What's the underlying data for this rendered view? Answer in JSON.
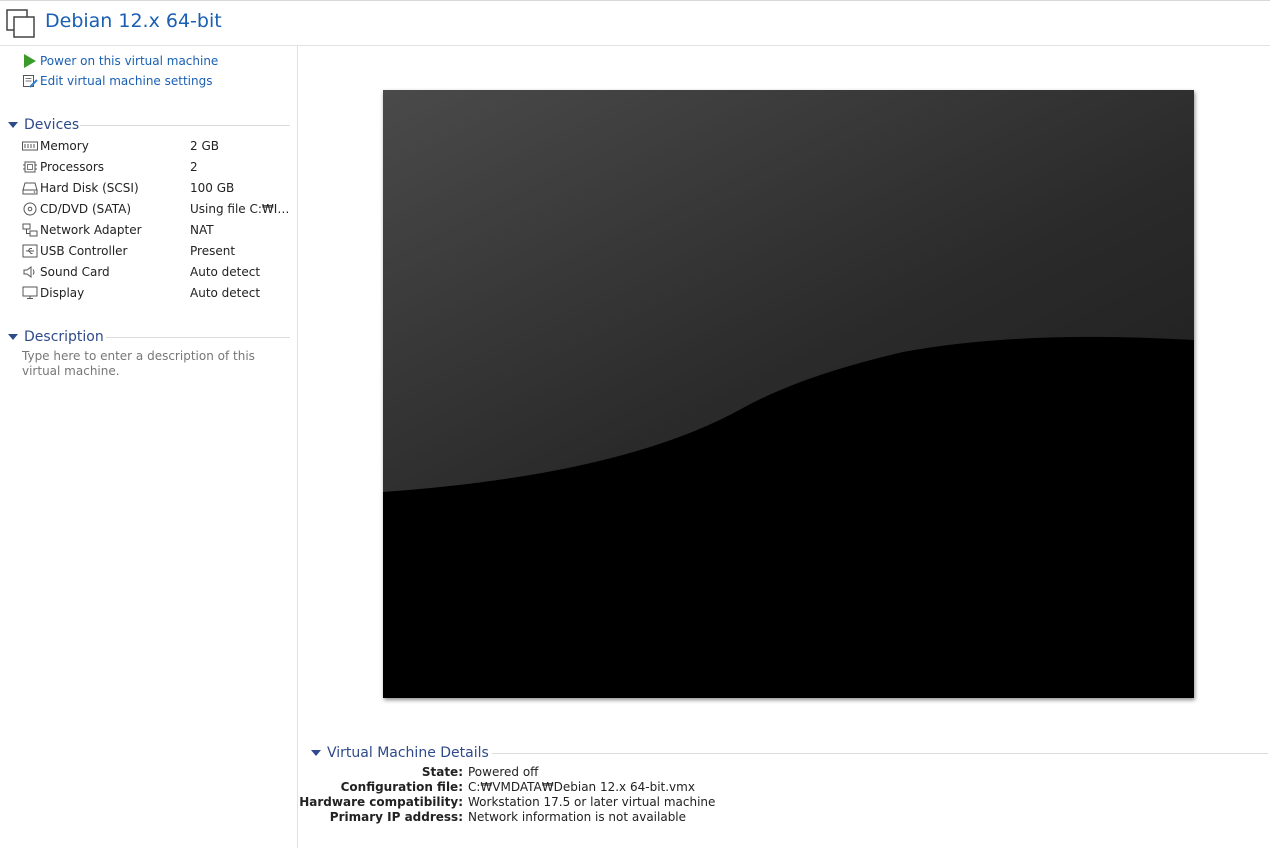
{
  "window": {
    "title": "Debian 12.x 64-bit"
  },
  "actions": [
    {
      "label": "Power on this virtual machine",
      "icon": "play-icon"
    },
    {
      "label": "Edit virtual machine settings",
      "icon": "edit-settings-icon"
    }
  ],
  "devices": {
    "heading": "Devices",
    "items": [
      {
        "name": "Memory",
        "value": "2 GB",
        "icon": "memory-icon"
      },
      {
        "name": "Processors",
        "value": "2",
        "icon": "processor-icon"
      },
      {
        "name": "Hard Disk (SCSI)",
        "value": "100 GB",
        "icon": "hard-disk-icon"
      },
      {
        "name": "CD/DVD (SATA)",
        "value": "Using file C:₩IS...",
        "icon": "cd-dvd-icon"
      },
      {
        "name": "Network Adapter",
        "value": "NAT",
        "icon": "network-icon"
      },
      {
        "name": "USB Controller",
        "value": "Present",
        "icon": "usb-icon"
      },
      {
        "name": "Sound Card",
        "value": "Auto detect",
        "icon": "speaker-icon"
      },
      {
        "name": "Display",
        "value": "Auto detect",
        "icon": "monitor-icon"
      }
    ]
  },
  "description": {
    "heading": "Description",
    "placeholder": "Type here to enter a description of this virtual machine."
  },
  "details": {
    "heading": "Virtual Machine Details",
    "rows": [
      {
        "key": "State:",
        "value": "Powered off"
      },
      {
        "key": "Configuration file:",
        "value": "C:₩VMDATA₩Debian 12.x 64-bit.vmx"
      },
      {
        "key": "Hardware compatibility:",
        "value": "Workstation 17.5 or later virtual machine"
      },
      {
        "key": "Primary IP address:",
        "value": "Network information is not available"
      }
    ]
  },
  "colors": {
    "link": "#1a5fb4",
    "section": "#2e4a8a",
    "play": "#3a9a2a"
  }
}
